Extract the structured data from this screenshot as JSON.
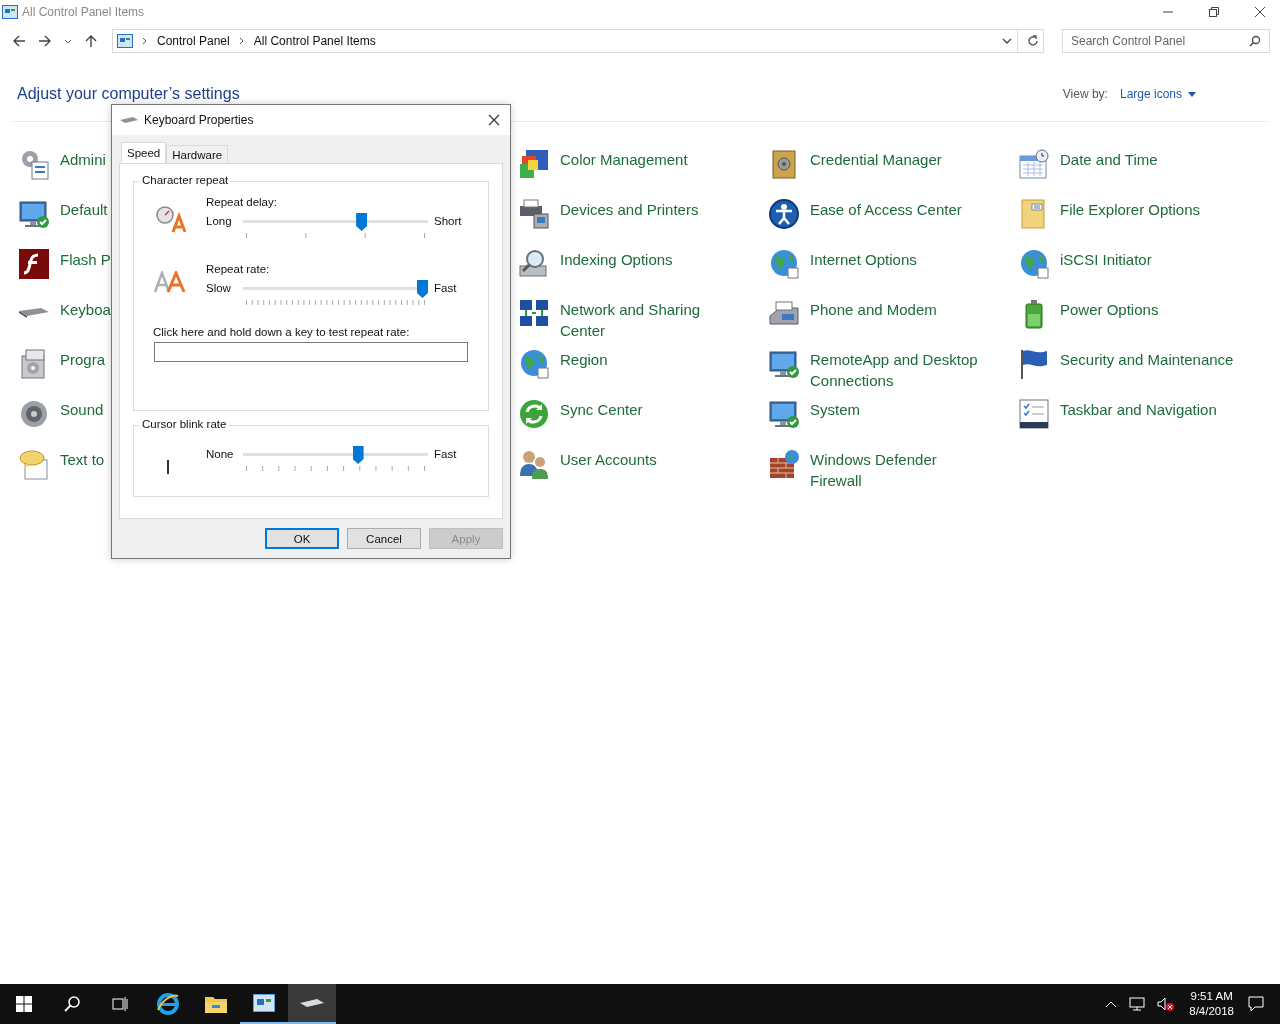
{
  "window": {
    "title": "All Control Panel Items"
  },
  "address_bar": {
    "breadcrumbs": [
      "Control Panel",
      "All Control Panel Items"
    ]
  },
  "search": {
    "placeholder": "Search Control Panel"
  },
  "heading": "Adjust your computer’s settings",
  "view_by": {
    "label": "View by:",
    "value": "Large icons"
  },
  "columns": [
    [
      "Admini",
      "Default",
      "Flash P",
      "Keyboa",
      "Progra",
      "Sound",
      "Text to"
    ],
    [
      "Color Management",
      "Devices and Printers",
      "Indexing Options",
      "Network and Sharing Center",
      "Region",
      "Sync Center",
      "User Accounts"
    ],
    [
      "Credential Manager",
      "Ease of Access Center",
      "Internet Options",
      "Phone and Modem",
      "RemoteApp and Desktop Connections",
      "System",
      "Windows Defender Firewall"
    ],
    [
      "Date and Time",
      "File Explorer Options",
      "iSCSI Initiator",
      "Power Options",
      "Security and Maintenance",
      "Taskbar and Navigation"
    ]
  ],
  "dialog": {
    "title": "Keyboard Properties",
    "tabs": [
      {
        "label": "Speed",
        "selected": true
      },
      {
        "label": "Hardware",
        "selected": false
      }
    ],
    "character_repeat": {
      "title": "Character repeat",
      "delay": {
        "label": "Repeat delay:",
        "min_label": "Long",
        "max_label": "Short",
        "level": 0.65
      },
      "rate": {
        "label": "Repeat rate:",
        "min_label": "Slow",
        "max_label": "Fast",
        "level": 1
      },
      "test_label": "Click here and hold down a key to test repeat rate:"
    },
    "cursor_blink": {
      "title": "Cursor blink rate",
      "min_label": "None",
      "max_label": "Fast",
      "level": 0.63
    },
    "buttons": [
      {
        "label": "OK",
        "default": true,
        "disabled": false
      },
      {
        "label": "Cancel",
        "default": false,
        "disabled": false
      },
      {
        "label": "Apply",
        "default": false,
        "disabled": true
      }
    ]
  },
  "taskbar": {
    "apps": [
      {
        "running": false,
        "selected": false
      },
      {
        "running": false,
        "selected": false
      },
      {
        "running": true,
        "selected": false
      },
      {
        "running": true,
        "selected": true
      }
    ],
    "clock": {
      "time": "9:51 AM",
      "date": "8/4/2018"
    }
  }
}
